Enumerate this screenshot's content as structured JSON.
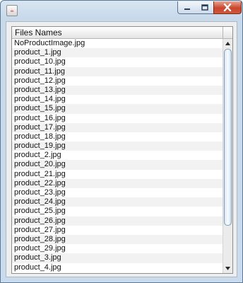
{
  "window": {
    "icon": "java-cup-icon",
    "controls": [
      "minimize-icon",
      "maximize-icon",
      "close-icon"
    ]
  },
  "table": {
    "column_header": "Files Names",
    "rows": [
      "NoProductImage.jpg",
      "product_1.jpg",
      "product_10.jpg",
      "product_11.jpg",
      "product_12.jpg",
      "product_13.jpg",
      "product_14.jpg",
      "product_15.jpg",
      "product_16.jpg",
      "product_17.jpg",
      "product_18.jpg",
      "product_19.jpg",
      "product_2.jpg",
      "product_20.jpg",
      "product_21.jpg",
      "product_22.jpg",
      "product_23.jpg",
      "product_24.jpg",
      "product_25.jpg",
      "product_26.jpg",
      "product_27.jpg",
      "product_28.jpg",
      "product_29.jpg",
      "product_3.jpg",
      "product_4.jpg"
    ]
  },
  "colors": {
    "title_bar": "#c8d9ea",
    "close_button": "#c9462c",
    "row_alt": "#f2f2f2"
  }
}
